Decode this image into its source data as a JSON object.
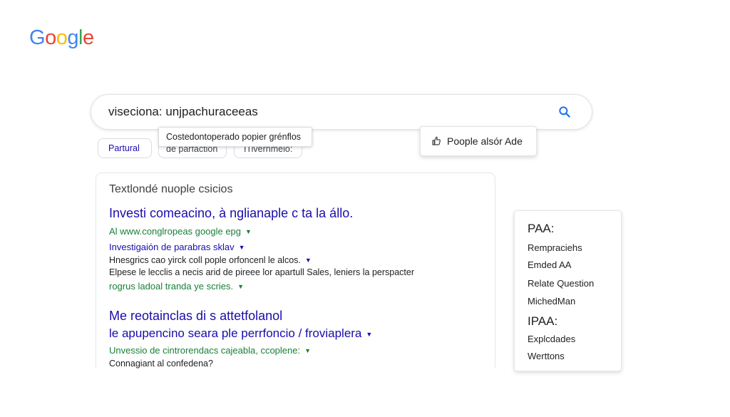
{
  "logo": {
    "letters": [
      "G",
      "o",
      "o",
      "g",
      "l",
      "e"
    ],
    "colors": [
      "#4285f4",
      "#ea4335",
      "#fbbc05",
      "#4285f4",
      "#34a853",
      "#ea4335"
    ]
  },
  "search": {
    "query": "viseciona: unjpachuraceeas",
    "icon": "search-icon"
  },
  "chips": {
    "chip1": "Partural",
    "chip2": "de parfaction",
    "chip3": "ITivernmelo:"
  },
  "tooltip": {
    "text": "Costedontoperado popier grénflos"
  },
  "paa_button": {
    "label": "Poople alsór Ade",
    "icon": "thumb-up-icon"
  },
  "results": {
    "heading": "Textlondé nuople csicios",
    "items": [
      {
        "title": "Investi comeacino, à nglianaple c ta la állo.",
        "url": "Al www.conglropeas google epg",
        "sublink": "Investigaión de parabras sklav",
        "snippet1": "Hnesgrics cao yirck coll pople orfoncenl le alcos.",
        "snippet2": "Elpese le lecclis a necis arid de pireee lor apartull Sales, leniers la perspacter",
        "green2": "rogrus ladoal tranda ye scries."
      },
      {
        "title1": "Me reotainclas  di s attetfolanol",
        "title2": "le apupencino seara ple perrfoncio / froviaplera",
        "green": "Unvessio de cintrorendacs cajeabla, ccoplene:",
        "snippet": "Connagiant al confedena?"
      }
    ]
  },
  "side_panel": {
    "heading1": "PAA:",
    "items1": [
      "Rempraciehs",
      "Emded AA",
      "Relate Question",
      "MichedMan"
    ],
    "heading2": "IPAA:",
    "items2": [
      "Explcdades",
      "Werttons"
    ]
  },
  "colors": {
    "link_blue": "#1a0dab",
    "url_green": "#188038",
    "accent_blue": "#1a73e8"
  }
}
